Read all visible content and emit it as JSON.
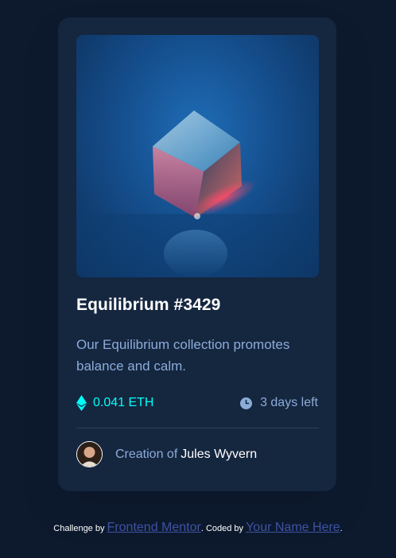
{
  "card": {
    "image_alt": "Equilibrium cube",
    "title": "Equilibrium #3429",
    "description": "Our Equilibrium collection promotes balance and calm.",
    "price": "0.041 ETH",
    "time_left": "3 days left",
    "creator_prefix": "Creation of",
    "creator_name": "Jules Wyvern",
    "icons": {
      "price": "ethereum-icon",
      "time": "clock-icon",
      "avatar": "avatar"
    }
  },
  "attribution": {
    "challenge_prefix": "Challenge by",
    "challenge_link": "Frontend Mentor",
    "coded_prefix": ". Coded by",
    "coder_link": "Your Name Here",
    "suffix": "."
  },
  "colors": {
    "background": "#0d1a2e",
    "card": "#15263f",
    "cyan": "#00fff8",
    "soft_blue": "#8bacd9",
    "white": "#ffffff",
    "link": "#3e52a3"
  }
}
